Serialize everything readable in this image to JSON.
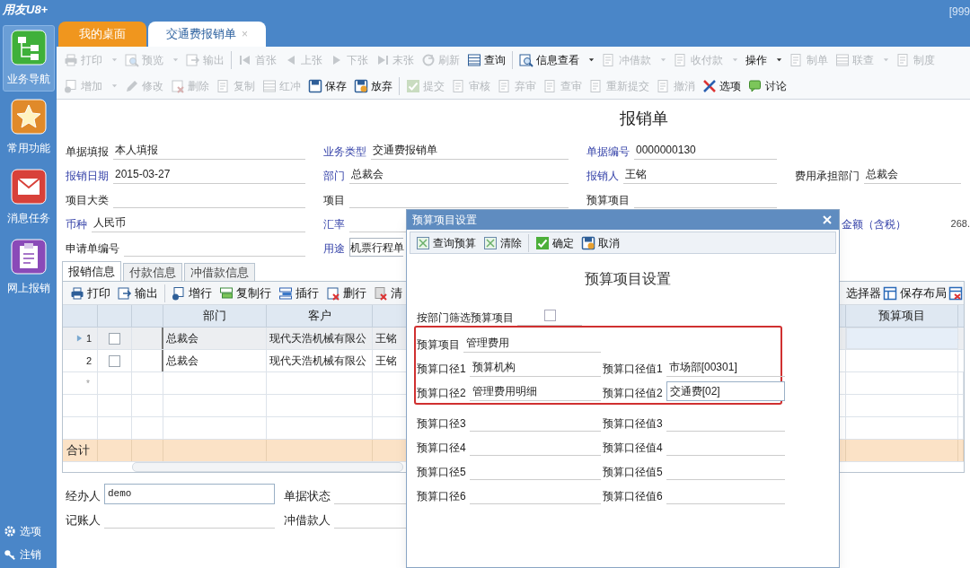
{
  "app": {
    "logo": "用友U8+",
    "account": "[999"
  },
  "sidebar": {
    "items": [
      {
        "label": "业务导航",
        "selected": true
      },
      {
        "label": "常用功能",
        "selected": false
      },
      {
        "label": "消息任务",
        "selected": false
      },
      {
        "label": "网上报销",
        "selected": false
      }
    ],
    "footer": [
      {
        "label": "选项"
      },
      {
        "label": "注销"
      }
    ]
  },
  "tabs": [
    {
      "label": "我的桌面",
      "selected": false
    },
    {
      "label": "交通费报销单",
      "selected": true,
      "close": "×"
    }
  ],
  "toolbar_rows": [
    [
      {
        "kind": "button",
        "label": "打印",
        "disabled": true,
        "dropdown": true
      },
      {
        "kind": "button",
        "label": "预览",
        "disabled": true,
        "dropdown": true
      },
      {
        "kind": "button",
        "label": "输出",
        "disabled": true,
        "dropdown": false
      },
      {
        "kind": "separator"
      },
      {
        "kind": "button",
        "label": "首张",
        "disabled": true,
        "dropdown": false
      },
      {
        "kind": "button",
        "label": "上张",
        "disabled": true,
        "dropdown": false
      },
      {
        "kind": "button",
        "label": "下张",
        "disabled": true,
        "dropdown": false
      },
      {
        "kind": "button",
        "label": "末张",
        "disabled": true,
        "dropdown": false
      },
      {
        "kind": "button",
        "label": "刷新",
        "disabled": true,
        "dropdown": false
      },
      {
        "kind": "button",
        "label": "查询",
        "disabled": false,
        "dropdown": false
      },
      {
        "kind": "separator"
      },
      {
        "kind": "button",
        "label": "信息查看",
        "disabled": false,
        "dropdown": true
      },
      {
        "kind": "button",
        "label": "冲借款",
        "disabled": true,
        "dropdown": true
      },
      {
        "kind": "button",
        "label": "收付款",
        "disabled": true,
        "dropdown": true
      },
      {
        "kind": "button",
        "label": "操作",
        "disabled": false,
        "dropdown": true
      },
      {
        "kind": "button",
        "label": "制单",
        "disabled": true,
        "dropdown": false
      },
      {
        "kind": "button",
        "label": "联查",
        "disabled": true,
        "dropdown": true
      },
      {
        "kind": "button",
        "label": "制度",
        "disabled": true,
        "dropdown": false
      }
    ],
    [
      {
        "kind": "button",
        "label": "增加",
        "disabled": true,
        "dropdown": true
      },
      {
        "kind": "button",
        "label": "修改",
        "disabled": true,
        "dropdown": false
      },
      {
        "kind": "button",
        "label": "删除",
        "disabled": true,
        "dropdown": false
      },
      {
        "kind": "button",
        "label": "复制",
        "disabled": true,
        "dropdown": false
      },
      {
        "kind": "button",
        "label": "红冲",
        "disabled": true,
        "dropdown": false
      },
      {
        "kind": "button",
        "label": "保存",
        "disabled": false,
        "dropdown": false
      },
      {
        "kind": "button",
        "label": "放弃",
        "disabled": false,
        "dropdown": false
      },
      {
        "kind": "separator"
      },
      {
        "kind": "button",
        "label": "提交",
        "disabled": true,
        "dropdown": false
      },
      {
        "kind": "button",
        "label": "审核",
        "disabled": true,
        "dropdown": false
      },
      {
        "kind": "button",
        "label": "弃审",
        "disabled": true,
        "dropdown": false
      },
      {
        "kind": "button",
        "label": "查审",
        "disabled": true,
        "dropdown": false
      },
      {
        "kind": "button",
        "label": "重新提交",
        "disabled": true,
        "dropdown": false
      },
      {
        "kind": "button",
        "label": "撤消",
        "disabled": true,
        "dropdown": false
      },
      {
        "kind": "button",
        "label": "选项",
        "disabled": false,
        "dropdown": false
      },
      {
        "kind": "button",
        "label": "讨论",
        "disabled": false,
        "dropdown": false
      }
    ]
  ],
  "form": {
    "title": "报销单",
    "rows": [
      [
        {
          "label": "单据填报",
          "value": "本人填报",
          "link": false
        },
        {
          "label": "业务类型",
          "value": "交通费报销单",
          "link": true
        },
        {
          "label": "单据编号",
          "value": "0000000130",
          "link": true
        },
        null
      ],
      [
        {
          "label": "报销日期",
          "value": "2015-03-27",
          "link": true
        },
        {
          "label": "部门",
          "value": "总裁会",
          "link": true
        },
        {
          "label": "报销人",
          "value": "王铭",
          "link": true
        },
        {
          "label": "费用承担部门",
          "value": "总裁会",
          "link": false
        }
      ],
      [
        {
          "label": "项目大类",
          "link": false
        },
        {
          "label": "项目",
          "link": false
        },
        {
          "label": "预算项目",
          "link": false
        },
        null
      ],
      [
        {
          "label": "币种",
          "value": "人民币",
          "link": true
        },
        {
          "label": "汇率",
          "link": true
        },
        null,
        {
          "kind": "amount",
          "label": "金额（含税）",
          "value": "268.",
          "link": true
        }
      ],
      [
        {
          "label": "申请单编号",
          "link": false
        },
        {
          "label": "用途",
          "value": "机票行程单",
          "link": true,
          "boxed": true
        },
        null,
        null
      ]
    ]
  },
  "detail_tabs": [
    {
      "label": "报销信息",
      "selected": true
    },
    {
      "label": "付款信息",
      "selected": false
    },
    {
      "label": "冲借款信息",
      "selected": false
    }
  ],
  "grid_toolbar": {
    "left": [
      {
        "kind": "button",
        "label": "打印"
      },
      {
        "kind": "button",
        "label": "输出"
      },
      {
        "kind": "separator"
      },
      {
        "kind": "button",
        "label": "增行"
      },
      {
        "kind": "button",
        "label": "复制行"
      },
      {
        "kind": "button",
        "label": "插行"
      },
      {
        "kind": "button",
        "label": "删行"
      },
      {
        "kind": "button",
        "label": "清"
      }
    ],
    "right": [
      {
        "kind": "button",
        "label": "选择器"
      },
      {
        "kind": "button",
        "label": "保存布局"
      },
      {
        "kind": "button"
      }
    ]
  },
  "table": {
    "columns": [
      "部门",
      "客户",
      "",
      "预算项目"
    ],
    "rows": [
      {
        "number": "1",
        "selected": true,
        "checked": false,
        "cells": [
          "总裁会",
          "现代天浩机械有限公",
          "王铭",
          ""
        ]
      },
      {
        "number": "2",
        "selected": false,
        "checked": false,
        "cells": [
          "总裁会",
          "现代天浩机械有限公",
          "王铭",
          ""
        ]
      }
    ],
    "new_row_marker": "*",
    "total_label": "合计"
  },
  "footer_fields": [
    {
      "label": "经办人",
      "value": "demo",
      "kind": "input"
    },
    {
      "label": "单据状态",
      "kind": "line"
    },
    {
      "label": "记账人",
      "kind": "line"
    },
    {
      "label": "冲借款人",
      "kind": "line"
    }
  ],
  "dialog": {
    "title": "预算项目设置",
    "toolbar": [
      {
        "kind": "button",
        "label": "查询预算"
      },
      {
        "kind": "button",
        "label": "清除"
      },
      {
        "kind": "separator"
      },
      {
        "kind": "button",
        "label": "确定"
      },
      {
        "kind": "button",
        "label": "取消"
      }
    ],
    "heading": "预算项目设置",
    "filter": {
      "label": "按部门筛选预算项目",
      "checked": false
    },
    "rows": [
      {
        "kind": "item",
        "label": "预算项目",
        "value": "管理费用",
        "highlighted": true
      },
      {
        "kind": "pair",
        "label": "预算口径1",
        "value": "预算机构",
        "label2": "预算口径值1",
        "value2": "市场部[00301]",
        "editing": false,
        "highlighted": true
      },
      {
        "kind": "pair",
        "label": "预算口径2",
        "value": "管理费用明细",
        "label2": "预算口径值2",
        "value2": "交通费[02]",
        "editing": true,
        "highlighted": true
      },
      {
        "kind": "pair",
        "label": "预算口径3",
        "label2": "预算口径值3",
        "editing": false,
        "highlighted": false
      },
      {
        "kind": "pair",
        "label": "预算口径4",
        "label2": "预算口径值4",
        "editing": false,
        "highlighted": false
      },
      {
        "kind": "pair",
        "label": "预算口径5",
        "label2": "预算口径值5",
        "editing": false,
        "highlighted": false
      },
      {
        "kind": "pair",
        "label": "预算口径6",
        "label2": "预算口径值6",
        "editing": false,
        "highlighted": false
      }
    ]
  }
}
